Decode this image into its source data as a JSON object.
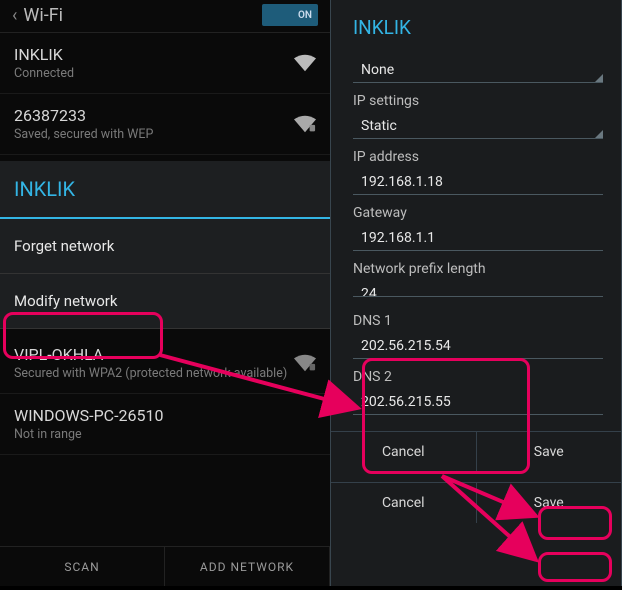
{
  "left": {
    "header_title": "Wi-Fi",
    "toggle_state": "ON",
    "networks": [
      {
        "name": "INKLIK",
        "sub": "Connected"
      },
      {
        "name": "26387233",
        "sub": "Saved, secured with WEP"
      }
    ],
    "dialog": {
      "title": "INKLIK",
      "forget": "Forget network",
      "modify": "Modify network"
    },
    "lower_networks": [
      {
        "name": "VIPL-OKHLA",
        "sub": "Secured with WPA2 (protected network available)"
      },
      {
        "name": "WINDOWS-PC-26510",
        "sub": "Not in range"
      }
    ],
    "scan": "SCAN",
    "add": "ADD NETWORK"
  },
  "right": {
    "title": "INKLIK",
    "security_select": "None",
    "ip_settings_label": "IP settings",
    "ip_settings_select": "Static",
    "ip_address_label": "IP address",
    "ip_address": "192.168.1.18",
    "gateway_label": "Gateway",
    "gateway": "192.168.1.1",
    "prefix_label": "Network prefix length",
    "prefix": "24",
    "dns1_label": "DNS 1",
    "dns1": "202.56.215.54",
    "dns2_label": "DNS 2",
    "dns2": "202.56.215.55",
    "cancel": "Cancel",
    "save": "Save"
  },
  "colors": {
    "accent": "#33b5e5",
    "highlight": "#e6005c"
  }
}
